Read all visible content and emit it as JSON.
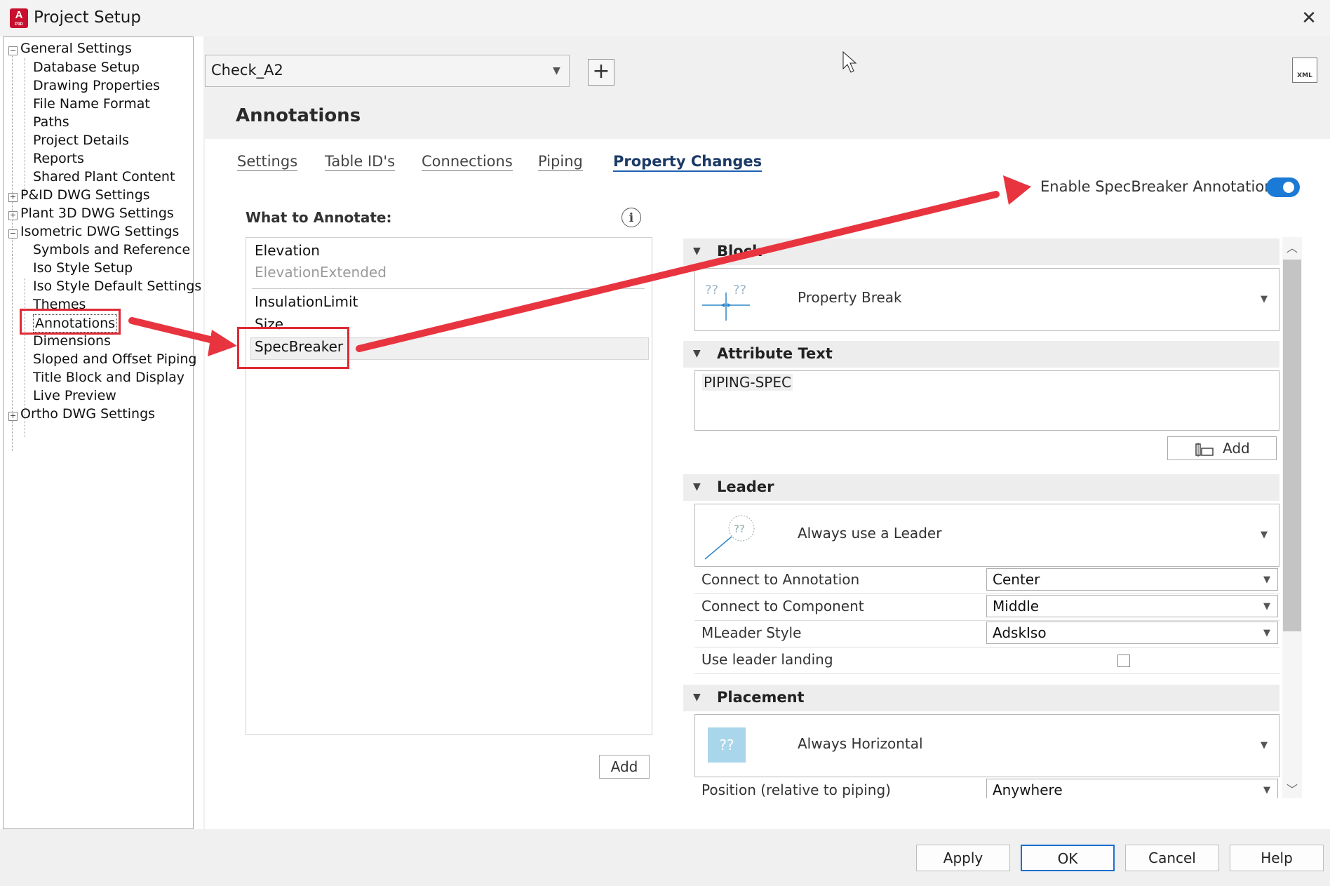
{
  "window": {
    "title": "Project Setup",
    "close_glyph": "✕",
    "app_icon_letter": "A",
    "app_icon_sub": "P3D"
  },
  "tree": {
    "items": [
      {
        "label": "General Settings",
        "level": 0,
        "expander": "−"
      },
      {
        "label": "Database Setup",
        "level": 1
      },
      {
        "label": "Drawing Properties",
        "level": 1
      },
      {
        "label": "File Name Format",
        "level": 1
      },
      {
        "label": "Paths",
        "level": 1
      },
      {
        "label": "Project Details",
        "level": 1
      },
      {
        "label": "Reports",
        "level": 1
      },
      {
        "label": "Shared Plant Content",
        "level": 1
      },
      {
        "label": "P&ID DWG Settings",
        "level": 0,
        "expander": "+"
      },
      {
        "label": "Plant 3D DWG Settings",
        "level": 0,
        "expander": "+"
      },
      {
        "label": "Isometric DWG Settings",
        "level": 0,
        "expander": "−"
      },
      {
        "label": "Symbols and Reference",
        "level": 1
      },
      {
        "label": "Iso Style Setup",
        "level": 1
      },
      {
        "label": "Iso Style Default Settings",
        "level": 1
      },
      {
        "label": "Themes",
        "level": 1
      },
      {
        "label": "Annotations",
        "level": 1,
        "selected": true
      },
      {
        "label": "Dimensions",
        "level": 1
      },
      {
        "label": "Sloped and Offset Piping",
        "level": 1
      },
      {
        "label": "Title Block and Display",
        "level": 1
      },
      {
        "label": "Live Preview",
        "level": 1
      },
      {
        "label": "Ortho DWG Settings",
        "level": 0,
        "expander": "+"
      }
    ]
  },
  "style_combo": {
    "value": "Check_A2",
    "arrow": "▼"
  },
  "add_style_glyph": "+",
  "xml_icon_label": "XML",
  "page_title": "Annotations",
  "tabs": [
    {
      "label": "Settings"
    },
    {
      "label": "Table ID's"
    },
    {
      "label": "Connections"
    },
    {
      "label": "Piping"
    },
    {
      "label": "Property Changes",
      "active": true
    }
  ],
  "enable_label": "Enable SpecBreaker Annotations:",
  "enable_state": true,
  "what_to_annotate": {
    "label": "What to Annotate:",
    "info_glyph": "i",
    "items": [
      "Elevation",
      "ElevationExtended",
      "InsulationLimit",
      "Size",
      "SpecBreaker"
    ],
    "selected": "SpecBreaker",
    "add_label": "Add"
  },
  "block": {
    "header": "Block",
    "value": "Property Break",
    "preview_text": "?? ??"
  },
  "attribute_text": {
    "header": "Attribute Text",
    "value": "PIPING-SPEC",
    "add_label": "Add"
  },
  "leader": {
    "header": "Leader",
    "value": "Always use a Leader",
    "preview_text": "??",
    "rows": [
      {
        "label": "Connect to Annotation",
        "value": "Center"
      },
      {
        "label": "Connect to Component",
        "value": "Middle"
      },
      {
        "label": "MLeader Style",
        "value": "AdskIso"
      },
      {
        "label": "Use leader landing",
        "checked": false
      }
    ]
  },
  "placement": {
    "header": "Placement",
    "value": "Always Horizontal",
    "preview_text": "??",
    "rows": [
      {
        "label": "Position (relative to piping)",
        "value": "Anywhere"
      }
    ]
  },
  "footer_buttons": [
    "Apply",
    "OK",
    "Cancel",
    "Help"
  ],
  "colors": {
    "accent": "#1b7ad6",
    "highlight": "#e02a36",
    "selection_bg": "#f0f0f0"
  }
}
